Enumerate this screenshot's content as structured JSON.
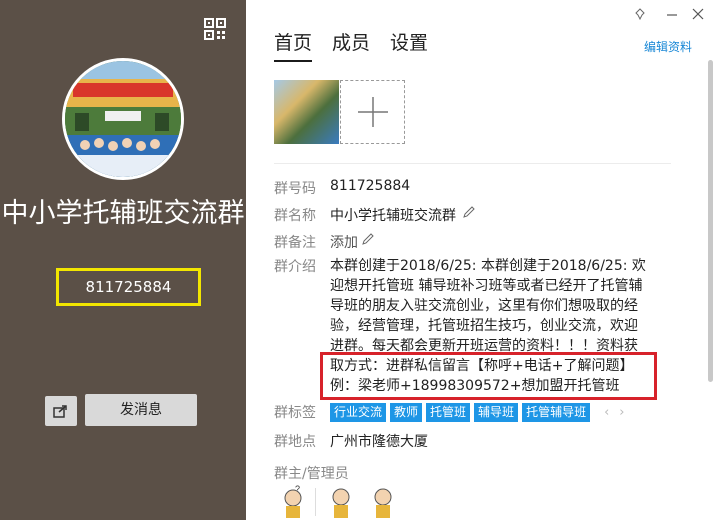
{
  "window": {
    "pin_icon": "pin-icon",
    "minimize_icon": "minimize-icon",
    "close_icon": "close-icon"
  },
  "left": {
    "group_name": "中小学托辅班交流群",
    "group_id": "811725884",
    "send_label": "发消息",
    "qr_icon": "qr-code-icon",
    "share_icon": "share-icon"
  },
  "tabs": [
    {
      "label": "首页",
      "active": true
    },
    {
      "label": "成员",
      "active": false
    },
    {
      "label": "设置",
      "active": false
    }
  ],
  "edit_label": "编辑资料",
  "info": {
    "number_label": "群号码",
    "number_value": "811725884",
    "name_label": "群名称",
    "name_value": "中小学托辅班交流群",
    "remark_label": "群备注",
    "remark_value": "添加",
    "intro_label": "群介绍",
    "intro_lines": [
      "本群创建于2018/6/25: 本群创建于2018/6/25: 欢",
      "迎想开托管班 辅导班补习班等或者已经开了托管辅",
      "导班的朋友入驻交流创业，这里有你们想吸取的经",
      "验，经营管理，托管班招生技巧，创业交流，欢迎",
      "进群。每天都会更新开班运营的资料！！！资料获",
      "取方式：进群私信留言【称呼+电话+了解问题】",
      "例：梁老师+18998309572+想加盟开托管班"
    ],
    "tags_label": "群标签",
    "tags": [
      "行业交流",
      "教师",
      "托管班",
      "辅导班",
      "托管辅导班"
    ],
    "location_label": "群地点",
    "location_value": "广州市隆德大厦",
    "admins_label": "群主/管理员"
  },
  "colors": {
    "left_bg": "#5b5047",
    "tag_bg": "#1e96e6",
    "link": "#1a88d6",
    "highlight_yellow": "#f2e600",
    "highlight_red": "#d7222a"
  }
}
